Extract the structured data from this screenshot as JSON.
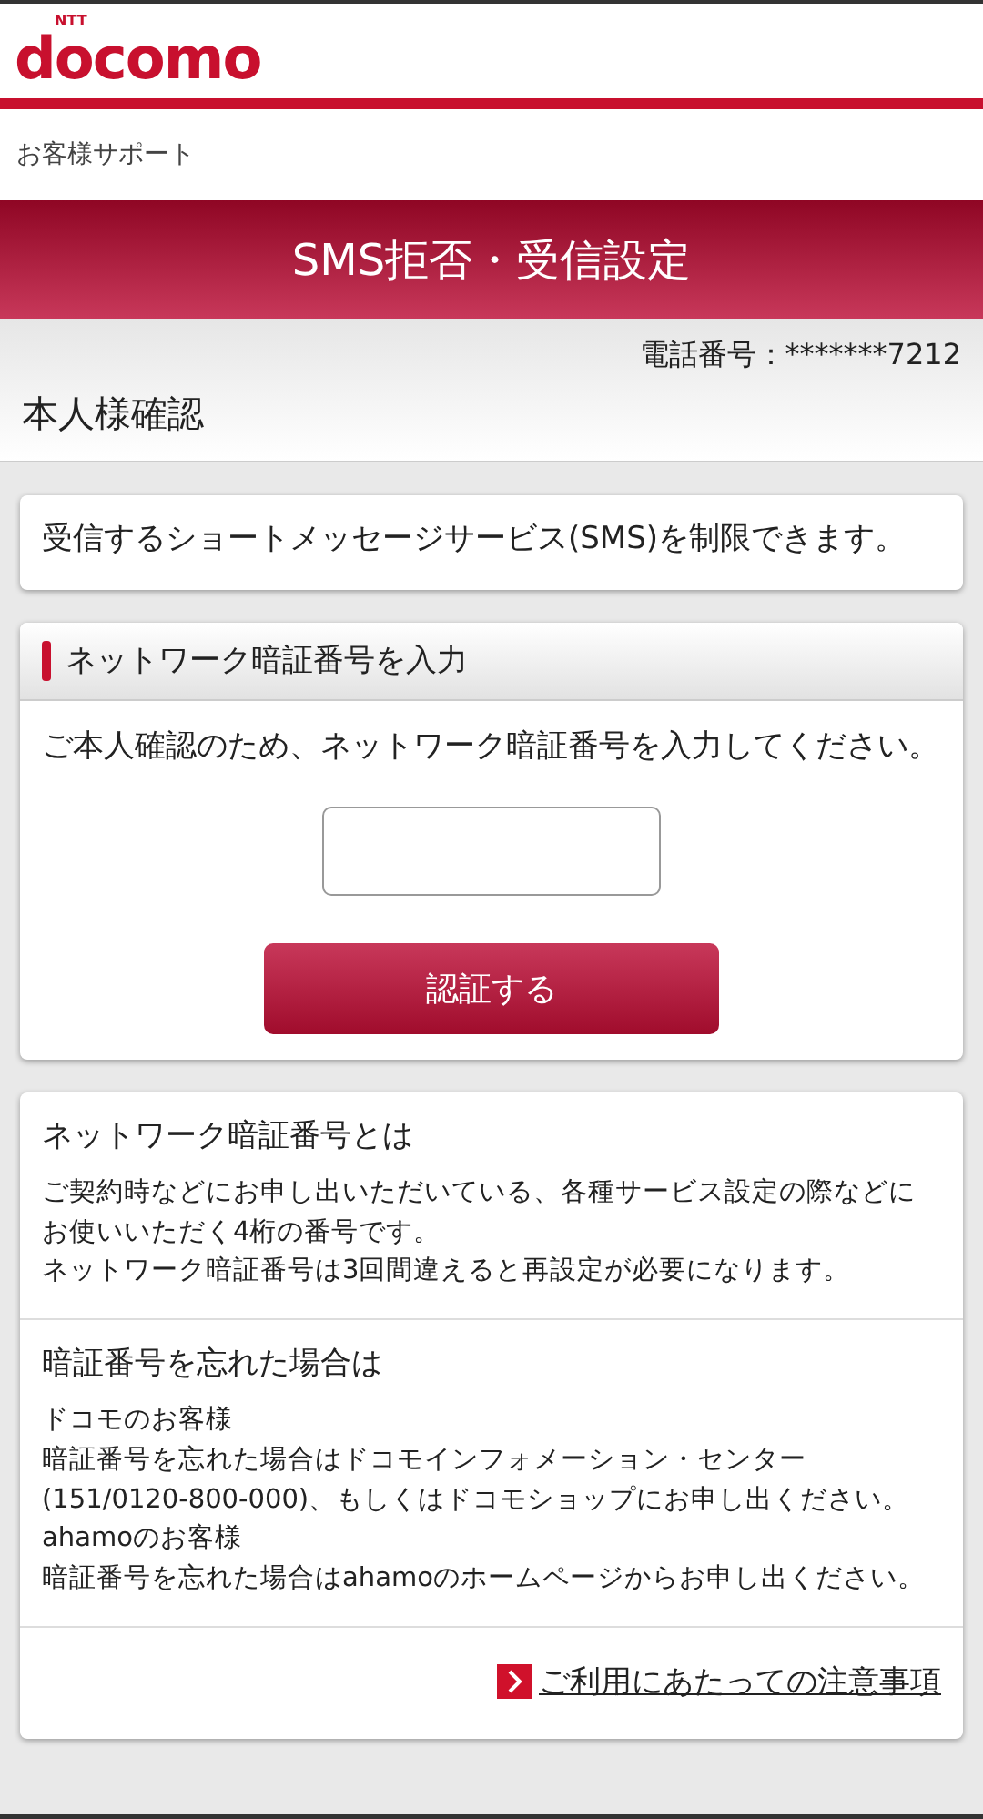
{
  "logo": {
    "brand": "docomo",
    "superscript": "NTT"
  },
  "breadcrumb": "お客様サポート",
  "page_title": "SMS拒否・受信設定",
  "phone_number": "電話番号：*******7212",
  "section_title": "本人様確認",
  "intro": "受信するショートメッセージサービス(SMS)を制限できます。",
  "pin_form": {
    "heading": "ネットワーク暗証番号を入力",
    "instruction": "ご本人確認のため、ネットワーク暗証番号を入力してください。",
    "submit": "認証する"
  },
  "info": [
    {
      "heading": "ネットワーク暗証番号とは",
      "lines": [
        "ご契約時などにお申し出いただいている、各種サービス設定の際などにお使いいただく4桁の番号です。",
        "ネットワーク暗証番号は3回間違えると再設定が必要になります。"
      ]
    },
    {
      "heading": "暗証番号を忘れた場合は",
      "lines": [
        "ドコモのお客様",
        "暗証番号を忘れた場合はドコモインフォメーション・センター(151/0120-800-000)、もしくはドコモショップにお申し出ください。",
        "ahamoのお客様",
        "暗証番号を忘れた場合はahamoのホームページからお申し出ください。"
      ]
    }
  ],
  "notes_link": "ご利用にあたっての注意事項"
}
